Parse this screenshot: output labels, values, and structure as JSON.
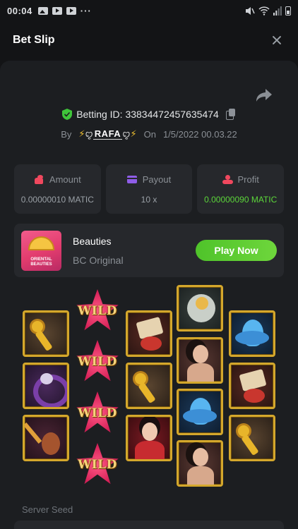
{
  "status_bar": {
    "time": "00:04",
    "dots": "···"
  },
  "header": {
    "title": "Bet Slip"
  },
  "bet": {
    "betting_id_label": "Betting ID: 338344724576354​74",
    "by_label": "By",
    "user": "RAFA",
    "on_label": "On",
    "date": "1/5/2022 00.03.22"
  },
  "stats": {
    "amount": {
      "label": "Amount",
      "value": "0.00000010 MATIC"
    },
    "payout": {
      "label": "Payout",
      "value": "10 x"
    },
    "profit": {
      "label": "Profit",
      "value": "0.00000090 MATIC"
    }
  },
  "game": {
    "thumb_text": "ORIENTAL BEAUTIES",
    "name": "Beauties",
    "provider": "BC Original",
    "play_label": "Play Now"
  },
  "reels": {
    "wild_label": "WILD",
    "columns": [
      [
        "key",
        "ring",
        "lute"
      ],
      [
        "wild",
        "wild",
        "wild",
        "wild"
      ],
      [
        "scroll",
        "key",
        "lady-red"
      ],
      [
        "fan",
        "lady",
        "lotus",
        "lady"
      ],
      [
        "lotus",
        "scroll",
        "key"
      ]
    ]
  },
  "footer": {
    "server_seed_label": "Server Seed"
  },
  "colors": {
    "accent_green": "#5cd63a",
    "wild_pink": "#d8235a",
    "gold_border": "#d4a72c"
  }
}
